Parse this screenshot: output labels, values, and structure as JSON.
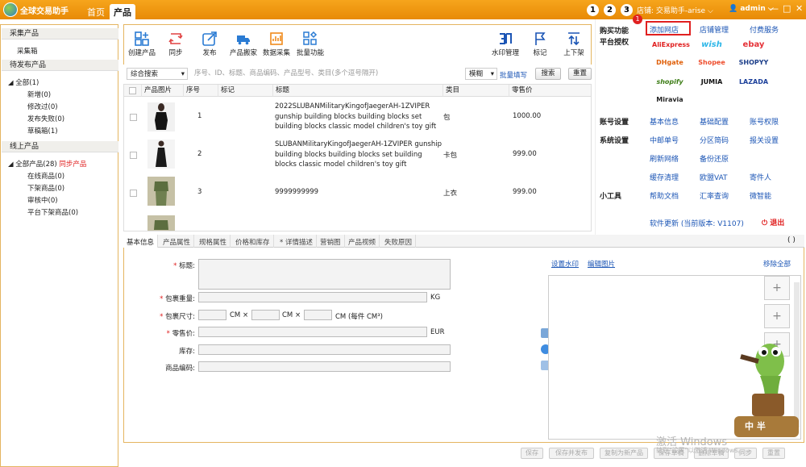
{
  "app": {
    "title": "全球交易助手",
    "tabs": [
      "首页",
      "产品"
    ]
  },
  "topbar": {
    "step_numbers": [
      "1",
      "2",
      "3"
    ],
    "store_label": "店铺: 交易助手-arise",
    "user": "admin",
    "window_buttons": [
      "—",
      "□",
      "✕"
    ]
  },
  "sidebar": {
    "sections": [
      {
        "title": "采集产品",
        "items": [
          "采集箱"
        ]
      },
      {
        "title": "待发布产品",
        "items": [
          "全部(1)",
          "新增(0)",
          "修改过(0)",
          "发布失败(0)",
          "草稿箱(1)"
        ]
      },
      {
        "title": "线上产品",
        "items": [
          "全部产品(28)",
          "在线商品(0)",
          "下架商品(0)",
          "审核中(0)",
          "平台下架商品(0)"
        ],
        "sync_link": "同步产品"
      }
    ]
  },
  "toolbar": {
    "buttons": [
      "创建产品",
      "同步",
      "发布",
      "产品搬家",
      "数据采集",
      "批量功能",
      "水印管理",
      "标记",
      "上下架"
    ],
    "icons": [
      "grid-add-icon",
      "sync-icon",
      "publish-icon",
      "truck-icon",
      "data-collect-icon",
      "batch-icon",
      "watermark-icon",
      "flag-icon",
      "shelf-icon"
    ]
  },
  "search": {
    "type": "综合搜索",
    "placeholder": "序号、ID、标题、商品编码、产品型号、类目(多个逗号隔开)",
    "mode": "模糊",
    "batch_fill": "批量填写",
    "search_btn": "搜索",
    "reset_btn": "重置"
  },
  "table": {
    "columns": [
      "产品图片",
      "序号",
      "标记",
      "标题",
      "类目",
      "零售价"
    ],
    "rows": [
      {
        "index": "1",
        "title": "2022SLUBANMilitaryKingofJaegerAH-1ZVIPER gunship building blocks building blocks set building blocks classic model children's toy gift",
        "category": "包",
        "price": "1000.00"
      },
      {
        "index": "2",
        "title": "SLUBANMilitaryKingofJaegerAH-1ZVIPER gunship building blocks building blocks set building blocks classic model children's toy gift",
        "category": "卡包",
        "price": "999.00"
      },
      {
        "index": "3",
        "title": "9999999999",
        "category": "上衣",
        "price": "999.00"
      }
    ]
  },
  "right": {
    "buy_label": "购买功能",
    "add_store": "添加网店",
    "store_manage": "店铺管理",
    "paid_service": "付费服务",
    "badge": "1",
    "platform_label": "平台授权",
    "platforms": [
      "AliExpress",
      "wish",
      "ebay",
      "DHgate",
      "Shopee",
      "SHOPYY",
      "shopify",
      "JUMIA",
      "LAZADA",
      "Miravia"
    ],
    "account_label": "账号设置",
    "account_links": [
      "基本信息",
      "基础配置",
      "账号权限"
    ],
    "system_label": "系统设置",
    "system_links": [
      "中邮单号",
      "分区简码",
      "报关设置",
      "刷新网络",
      "备份还原",
      "缓存清理",
      "欧盟VAT",
      "寄件人"
    ],
    "tools_label": "小工具",
    "tools_links": [
      "帮助文档",
      "汇率查询",
      "微智能"
    ],
    "update": "软件更新 (当前版本: V1107)",
    "exit": "退出"
  },
  "form": {
    "tabs": [
      "基本信息",
      "产品属性",
      "规格属性",
      "价格和库存",
      "* 详情描述",
      "营销图",
      "产品视频",
      "失败原因"
    ],
    "fields": {
      "title": "标题:",
      "weight": "包裹重量:",
      "size": "包裹尺寸:",
      "price": "零售价:",
      "stock": "库存:",
      "sku": "商品编码:"
    },
    "units": {
      "kg": "KG",
      "cm": "CM",
      "x": "×",
      "per": "CM (每件   CM³)",
      "eur": "EUR"
    },
    "image_links": {
      "watermark": "设置水印",
      "edit": "编辑图片",
      "remove_all": "移除全部"
    },
    "paren": "( )"
  },
  "bottom": {
    "buttons": [
      "保存",
      "保存并发布",
      "复制为新产品",
      "保存草稿",
      "删除草稿",
      "同步",
      "重置"
    ]
  },
  "watermark": {
    "line1": "激活 Windows",
    "line2": "转到\"设置\"以激活 Windows。"
  },
  "mascot_text": "中 半",
  "colors": {
    "accent": "#f39a10",
    "link": "#1b55b5",
    "red": "#e02020"
  }
}
